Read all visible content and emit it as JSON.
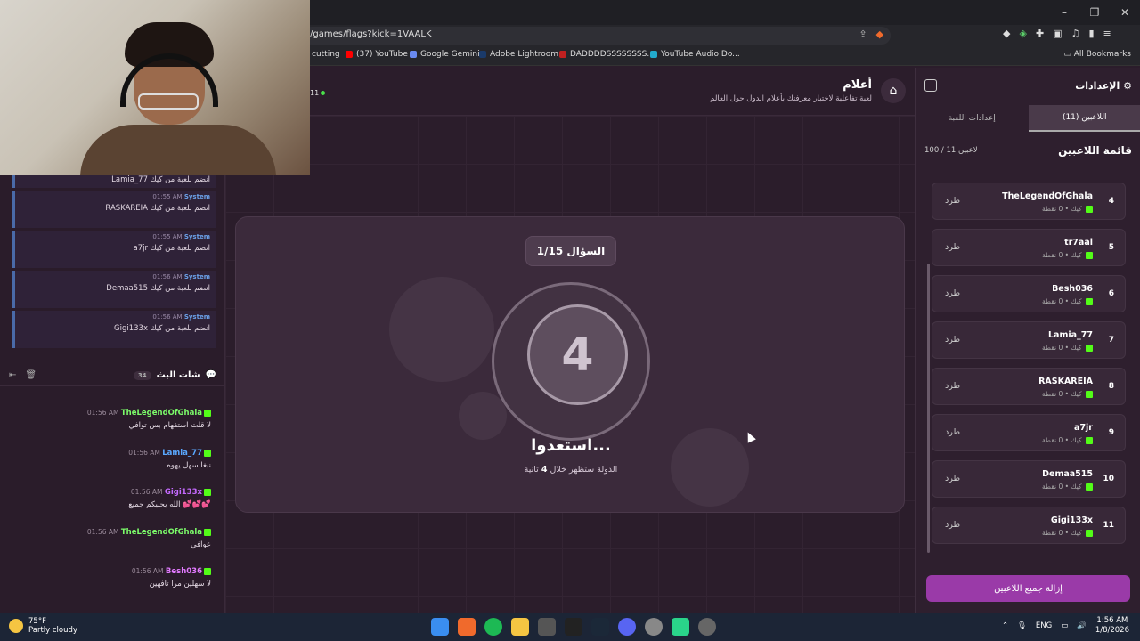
{
  "browser": {
    "url": "/games/flags?kick=1VAALK",
    "bookmarks": [
      "cutting",
      "(37) YouTube",
      "Google Gemini",
      "Adobe Lightroom",
      "DADDDDSSSSSSSS...",
      "YouTube Audio Do..."
    ],
    "all_bookmarks": "All Bookmarks"
  },
  "left_chat": {
    "system_messages": [
      {
        "time": "01:55 AM",
        "sender": "System",
        "text": "RASKAREIA انضم للعبة من كيك"
      },
      {
        "time": "01:55 AM",
        "sender": "System",
        "text": "a7jr انضم للعبة من كيك"
      },
      {
        "time": "01:56 AM",
        "sender": "System",
        "text": "Demaa515 انضم للعبة من كيك"
      },
      {
        "time": "01:56 AM",
        "sender": "System",
        "text": "Gigi133x انضم للعبة من كيك"
      }
    ],
    "header_title": "شات البث",
    "header_count": "34",
    "messages": [
      {
        "time": "01:56 AM",
        "user": "TheLegendOfGhala",
        "user_color": "#7cfc6a",
        "text": "لا قلت استفهام بس توافي"
      },
      {
        "time": "01:56 AM",
        "user": "Lamia_77",
        "user_color": "#5aa8ff",
        "text": "نبغا سهل يهوه"
      },
      {
        "time": "01:56 AM",
        "user": "Gigi133x",
        "user_color": "#c56aff",
        "text": "الله يحبيكم جميع 💕💕💕"
      },
      {
        "time": "01:56 AM",
        "user": "TheLegendOfGhala",
        "user_color": "#7cfc6a",
        "text": "عوافي"
      },
      {
        "time": "01:56 AM",
        "user": "Besh036",
        "user_color": "#e27aff",
        "text": "لا سهلين مرا تافهين"
      }
    ]
  },
  "game": {
    "title": "أعلام",
    "subtitle": "لعبة تفاعلية لاختبار معرفتك بأعلام الدول حول العالم",
    "live_count": "11",
    "question_label": "السؤال 1/15",
    "countdown": "4",
    "ready_text": "استعدوا...",
    "ready_sub_prefix": "الدولة ستظهر خلال",
    "ready_sub_seconds": "4",
    "ready_sub_suffix": "ثانية"
  },
  "settings": {
    "title": "الإعدادات",
    "tab_players": "اللاعبين (11)",
    "tab_game": "إعدادات اللعبة",
    "players_title": "قائمة اللاعبين",
    "players_count": "100 / 11 لاعبين",
    "kick_label": "طرد",
    "player_sub": "كيك • 0 نقطة",
    "players": [
      {
        "num": "4",
        "name": "TheLegendOfGhala"
      },
      {
        "num": "5",
        "name": "tr7aal"
      },
      {
        "num": "6",
        "name": "Besh036"
      },
      {
        "num": "7",
        "name": "Lamia_77"
      },
      {
        "num": "8",
        "name": "RASKAREIA"
      },
      {
        "num": "9",
        "name": "a7jr"
      },
      {
        "num": "10",
        "name": "Demaa515"
      },
      {
        "num": "11",
        "name": "Gigi133x"
      }
    ],
    "remove_all": "إزالة جميع اللاعبين"
  },
  "taskbar": {
    "temp": "75°F",
    "weather": "Partly cloudy",
    "lang": "ENG",
    "time": "1:56 AM",
    "date": "1/8/2026"
  }
}
